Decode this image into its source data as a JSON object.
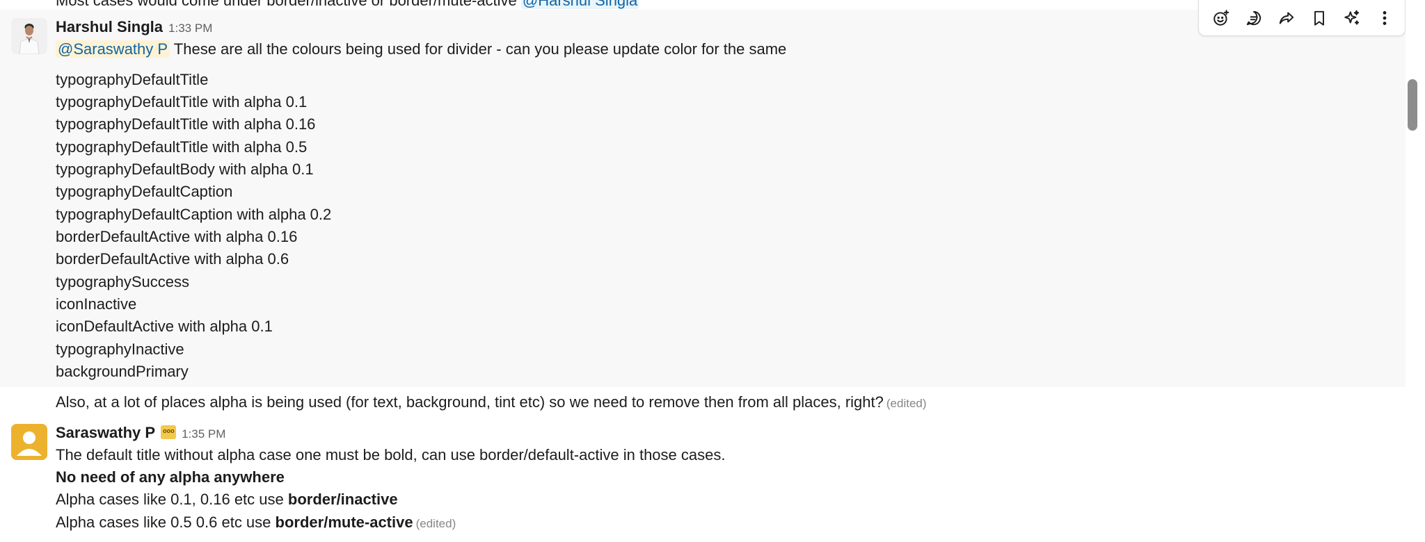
{
  "previous_message": {
    "text": "Most cases would come under border/inactive or border/mute-active",
    "mention": "@Harshul Singla"
  },
  "messages": [
    {
      "sender": "Harshul Singla",
      "time": "1:33 PM",
      "mention": "@Saraswathy P",
      "intro": "These are all the colours being used for divider - can you please update color for the same",
      "list": [
        "typographyDefaultTitle",
        "typographyDefaultTitle with alpha 0.1",
        "typographyDefaultTitle with alpha 0.16",
        "typographyDefaultTitle with alpha 0.5",
        "typographyDefaultBody with alpha 0.1",
        "typographyDefaultCaption",
        "typographyDefaultCaption with alpha 0.2",
        "borderDefaultActive with alpha 0.16",
        "borderDefaultActive with alpha 0.6",
        "typographySuccess",
        "iconInactive",
        "iconDefaultActive with alpha 0.1",
        "typographyInactive",
        "backgroundPrimary"
      ],
      "followup": "Also, at a lot of places alpha is being used (for text, background, tint etc) so we need to remove then from all places, right?",
      "followup_edited": "(edited)"
    },
    {
      "sender": "Saraswathy P",
      "time": "1:35 PM",
      "status_emoji": "ooo-icon",
      "line1": "The default title without alpha case one must be bold, can use border/default-active in those cases.",
      "line2": "No need of any alpha anywhere",
      "line3_prefix": "Alpha cases like 0.1, 0.16 etc use ",
      "line3_bold": "border/inactive",
      "line4_prefix": "Alpha cases like 0.5 0.6 etc use ",
      "line4_bold": "border/mute-active",
      "line4_edited": "(edited)"
    }
  ],
  "toolbar": {
    "icons": [
      "add-reaction-icon",
      "reply-in-thread-icon",
      "share-message-icon",
      "save-bookmark-icon",
      "ai-sparkle-icon",
      "more-actions-icon"
    ]
  },
  "colors": {
    "mention_text": "#1264a3",
    "mention_bg": "#fdf3d4",
    "hover_bg": "#f8f8f8",
    "timestamp": "#616061"
  }
}
